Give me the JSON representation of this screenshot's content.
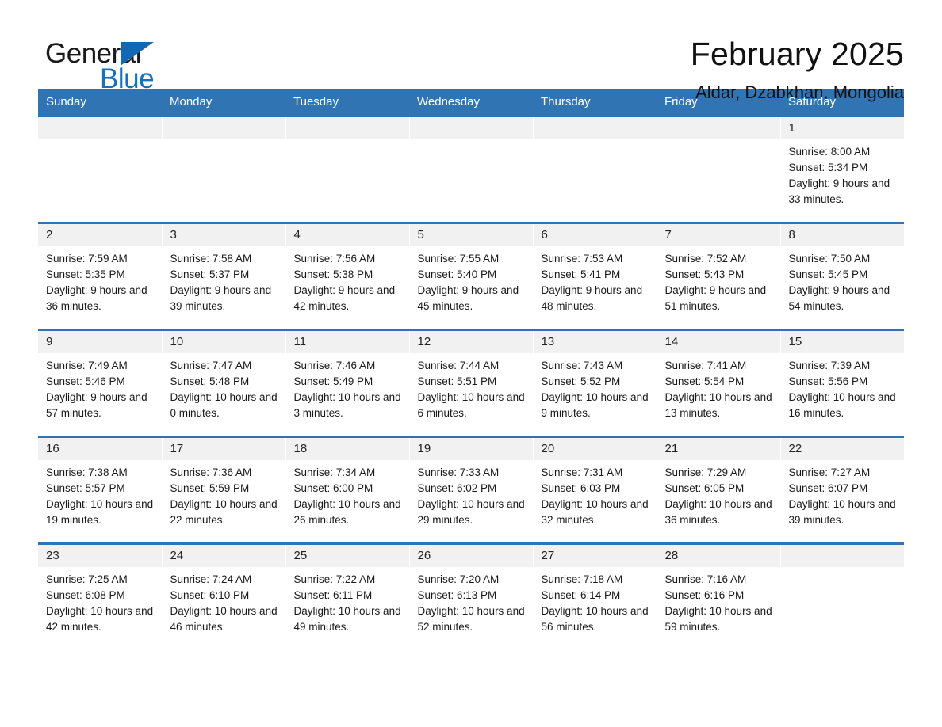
{
  "brand": {
    "name_part1": "General",
    "name_part2": "Blue",
    "triangle_color": "#1268b3",
    "blue_color": "#1271c0"
  },
  "header": {
    "month_title": "February 2025",
    "location": "Aldar, Dzabkhan, Mongolia"
  },
  "theme": {
    "header_blue": "#3174b4",
    "row_border_blue": "#2e74b5",
    "daynum_band": "#f1f1f1"
  },
  "calendar": {
    "weekday_headers": [
      "Sunday",
      "Monday",
      "Tuesday",
      "Wednesday",
      "Thursday",
      "Friday",
      "Saturday"
    ],
    "weeks": [
      [
        {
          "day": "",
          "blank": true
        },
        {
          "day": "",
          "blank": true
        },
        {
          "day": "",
          "blank": true
        },
        {
          "day": "",
          "blank": true
        },
        {
          "day": "",
          "blank": true
        },
        {
          "day": "",
          "blank": true
        },
        {
          "day": "1",
          "sunrise": "Sunrise: 8:00 AM",
          "sunset": "Sunset: 5:34 PM",
          "daylight": "Daylight: 9 hours and 33 minutes."
        }
      ],
      [
        {
          "day": "2",
          "sunrise": "Sunrise: 7:59 AM",
          "sunset": "Sunset: 5:35 PM",
          "daylight": "Daylight: 9 hours and 36 minutes."
        },
        {
          "day": "3",
          "sunrise": "Sunrise: 7:58 AM",
          "sunset": "Sunset: 5:37 PM",
          "daylight": "Daylight: 9 hours and 39 minutes."
        },
        {
          "day": "4",
          "sunrise": "Sunrise: 7:56 AM",
          "sunset": "Sunset: 5:38 PM",
          "daylight": "Daylight: 9 hours and 42 minutes."
        },
        {
          "day": "5",
          "sunrise": "Sunrise: 7:55 AM",
          "sunset": "Sunset: 5:40 PM",
          "daylight": "Daylight: 9 hours and 45 minutes."
        },
        {
          "day": "6",
          "sunrise": "Sunrise: 7:53 AM",
          "sunset": "Sunset: 5:41 PM",
          "daylight": "Daylight: 9 hours and 48 minutes."
        },
        {
          "day": "7",
          "sunrise": "Sunrise: 7:52 AM",
          "sunset": "Sunset: 5:43 PM",
          "daylight": "Daylight: 9 hours and 51 minutes."
        },
        {
          "day": "8",
          "sunrise": "Sunrise: 7:50 AM",
          "sunset": "Sunset: 5:45 PM",
          "daylight": "Daylight: 9 hours and 54 minutes."
        }
      ],
      [
        {
          "day": "9",
          "sunrise": "Sunrise: 7:49 AM",
          "sunset": "Sunset: 5:46 PM",
          "daylight": "Daylight: 9 hours and 57 minutes."
        },
        {
          "day": "10",
          "sunrise": "Sunrise: 7:47 AM",
          "sunset": "Sunset: 5:48 PM",
          "daylight": "Daylight: 10 hours and 0 minutes."
        },
        {
          "day": "11",
          "sunrise": "Sunrise: 7:46 AM",
          "sunset": "Sunset: 5:49 PM",
          "daylight": "Daylight: 10 hours and 3 minutes."
        },
        {
          "day": "12",
          "sunrise": "Sunrise: 7:44 AM",
          "sunset": "Sunset: 5:51 PM",
          "daylight": "Daylight: 10 hours and 6 minutes."
        },
        {
          "day": "13",
          "sunrise": "Sunrise: 7:43 AM",
          "sunset": "Sunset: 5:52 PM",
          "daylight": "Daylight: 10 hours and 9 minutes."
        },
        {
          "day": "14",
          "sunrise": "Sunrise: 7:41 AM",
          "sunset": "Sunset: 5:54 PM",
          "daylight": "Daylight: 10 hours and 13 minutes."
        },
        {
          "day": "15",
          "sunrise": "Sunrise: 7:39 AM",
          "sunset": "Sunset: 5:56 PM",
          "daylight": "Daylight: 10 hours and 16 minutes."
        }
      ],
      [
        {
          "day": "16",
          "sunrise": "Sunrise: 7:38 AM",
          "sunset": "Sunset: 5:57 PM",
          "daylight": "Daylight: 10 hours and 19 minutes."
        },
        {
          "day": "17",
          "sunrise": "Sunrise: 7:36 AM",
          "sunset": "Sunset: 5:59 PM",
          "daylight": "Daylight: 10 hours and 22 minutes."
        },
        {
          "day": "18",
          "sunrise": "Sunrise: 7:34 AM",
          "sunset": "Sunset: 6:00 PM",
          "daylight": "Daylight: 10 hours and 26 minutes."
        },
        {
          "day": "19",
          "sunrise": "Sunrise: 7:33 AM",
          "sunset": "Sunset: 6:02 PM",
          "daylight": "Daylight: 10 hours and 29 minutes."
        },
        {
          "day": "20",
          "sunrise": "Sunrise: 7:31 AM",
          "sunset": "Sunset: 6:03 PM",
          "daylight": "Daylight: 10 hours and 32 minutes."
        },
        {
          "day": "21",
          "sunrise": "Sunrise: 7:29 AM",
          "sunset": "Sunset: 6:05 PM",
          "daylight": "Daylight: 10 hours and 36 minutes."
        },
        {
          "day": "22",
          "sunrise": "Sunrise: 7:27 AM",
          "sunset": "Sunset: 6:07 PM",
          "daylight": "Daylight: 10 hours and 39 minutes."
        }
      ],
      [
        {
          "day": "23",
          "sunrise": "Sunrise: 7:25 AM",
          "sunset": "Sunset: 6:08 PM",
          "daylight": "Daylight: 10 hours and 42 minutes."
        },
        {
          "day": "24",
          "sunrise": "Sunrise: 7:24 AM",
          "sunset": "Sunset: 6:10 PM",
          "daylight": "Daylight: 10 hours and 46 minutes."
        },
        {
          "day": "25",
          "sunrise": "Sunrise: 7:22 AM",
          "sunset": "Sunset: 6:11 PM",
          "daylight": "Daylight: 10 hours and 49 minutes."
        },
        {
          "day": "26",
          "sunrise": "Sunrise: 7:20 AM",
          "sunset": "Sunset: 6:13 PM",
          "daylight": "Daylight: 10 hours and 52 minutes."
        },
        {
          "day": "27",
          "sunrise": "Sunrise: 7:18 AM",
          "sunset": "Sunset: 6:14 PM",
          "daylight": "Daylight: 10 hours and 56 minutes."
        },
        {
          "day": "28",
          "sunrise": "Sunrise: 7:16 AM",
          "sunset": "Sunset: 6:16 PM",
          "daylight": "Daylight: 10 hours and 59 minutes."
        },
        {
          "day": "",
          "blank": true
        }
      ]
    ]
  }
}
